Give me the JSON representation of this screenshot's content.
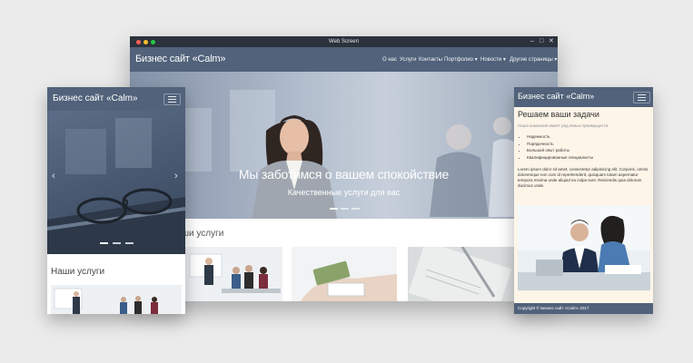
{
  "window": {
    "title": "Web Screen",
    "brand": "Бизнес сайт «Calm»",
    "nav": [
      {
        "label": "О нас"
      },
      {
        "label": "Услуги"
      },
      {
        "label": "Контакты"
      },
      {
        "label": "Портфолио ▾"
      },
      {
        "label": "Новости ▾"
      },
      {
        "label": "Другие страницы ▾"
      }
    ],
    "hero": {
      "heading": "Мы заботимся о вашем спокойствие",
      "subheading": "Качественные услуги для вас"
    },
    "services_title": "ши услуги"
  },
  "left_phone": {
    "brand": "Бизнес сайт «Calm»",
    "services_title": "Наши услуги"
  },
  "right_phone": {
    "brand": "Бизнес сайт «Calm»",
    "heading": "Решаем ваши задачи",
    "subtext": "Наша компания имеет ряд явных преимуществ:",
    "list": [
      "Надежность",
      "Порядочность",
      "Большой опыт работы",
      "Квалифицированные специалисты"
    ],
    "paragraph": "Lorem ipsum dolor sit amet, consectetur adipisicing elit. Corporis, omnis doloremque non cum id reprehenderit, quisquam totam aspernatur tempora minima unde aliquid ea culpa sunt. Reiciendis quia dolorum ducimus unde.",
    "footer": "Copyright © Бизнес сайт «Calm» 2017"
  },
  "colors": {
    "nav": "#51627a",
    "window_bar": "#2b323c",
    "page_bg": "#ebebeb",
    "cream": "#fdf5e8"
  }
}
